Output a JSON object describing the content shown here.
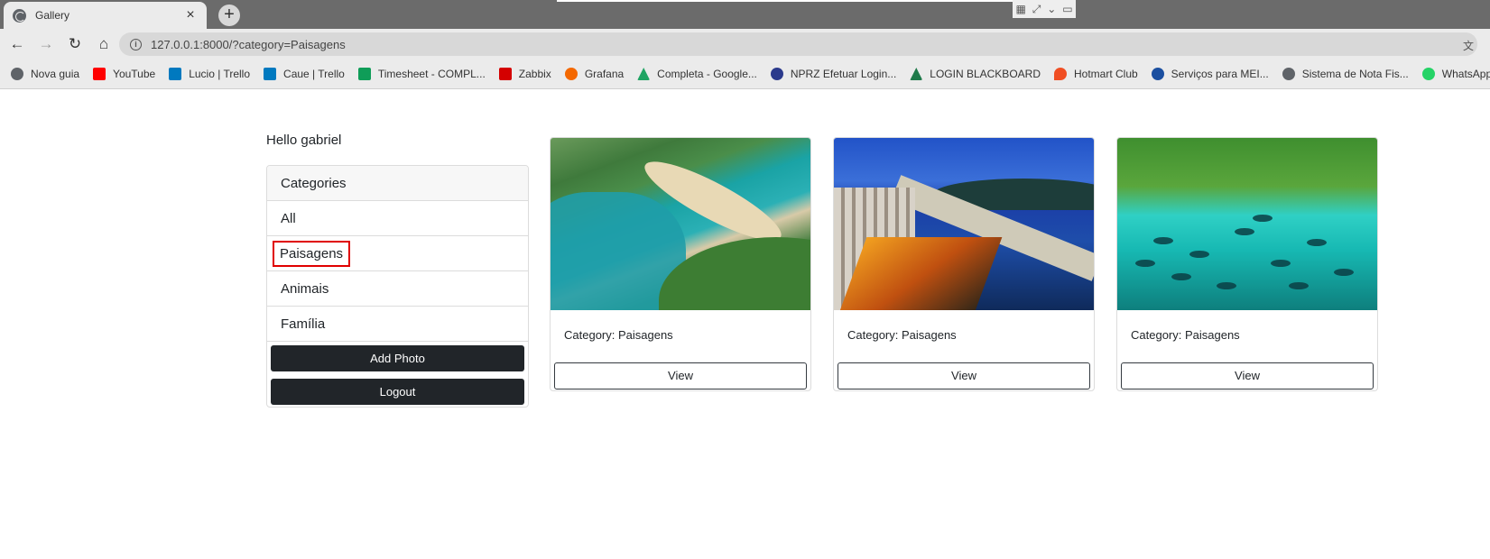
{
  "browser": {
    "tab": {
      "title": "Gallery",
      "close": "×"
    },
    "new_tab": "+",
    "url": "127.0.0.1:8000/?category=Paisagens",
    "bookmarks": [
      {
        "label": "Nova guia",
        "color": "#5f6368"
      },
      {
        "label": "YouTube",
        "color": "#ff0000"
      },
      {
        "label": "Lucio | Trello",
        "color": "#0079bf"
      },
      {
        "label": "Caue | Trello",
        "color": "#0079bf"
      },
      {
        "label": "Timesheet - COMPL...",
        "color": "#0f9d58"
      },
      {
        "label": "Zabbix",
        "color": "#d40000"
      },
      {
        "label": "Grafana",
        "color": "#f46800"
      },
      {
        "label": "Completa - Google...",
        "color": "#1fa463"
      },
      {
        "label": "NPRZ Efetuar Login...",
        "color": "#2b3a8c"
      },
      {
        "label": "LOGIN BLACKBOARD",
        "color": "#1f7a4a"
      },
      {
        "label": "Hotmart Club",
        "color": "#f04e23"
      },
      {
        "label": "Serviços para MEI...",
        "color": "#1b4fa0"
      },
      {
        "label": "Sistema de Nota Fis...",
        "color": "#5f6368"
      },
      {
        "label": "WhatsApp",
        "color": "#25d366"
      }
    ]
  },
  "page": {
    "greeting": "Hello gabriel",
    "sidebar": {
      "header": "Categories",
      "items": [
        "All",
        "Paisagens",
        "Animais",
        "Família"
      ],
      "selected": "Paisagens",
      "add_photo": "Add Photo",
      "logout": "Logout"
    },
    "cards": [
      {
        "caption": "Category: Paisagens",
        "view": "View"
      },
      {
        "caption": "Category: Paisagens",
        "view": "View"
      },
      {
        "caption": "Category: Paisagens",
        "view": "View"
      }
    ]
  }
}
